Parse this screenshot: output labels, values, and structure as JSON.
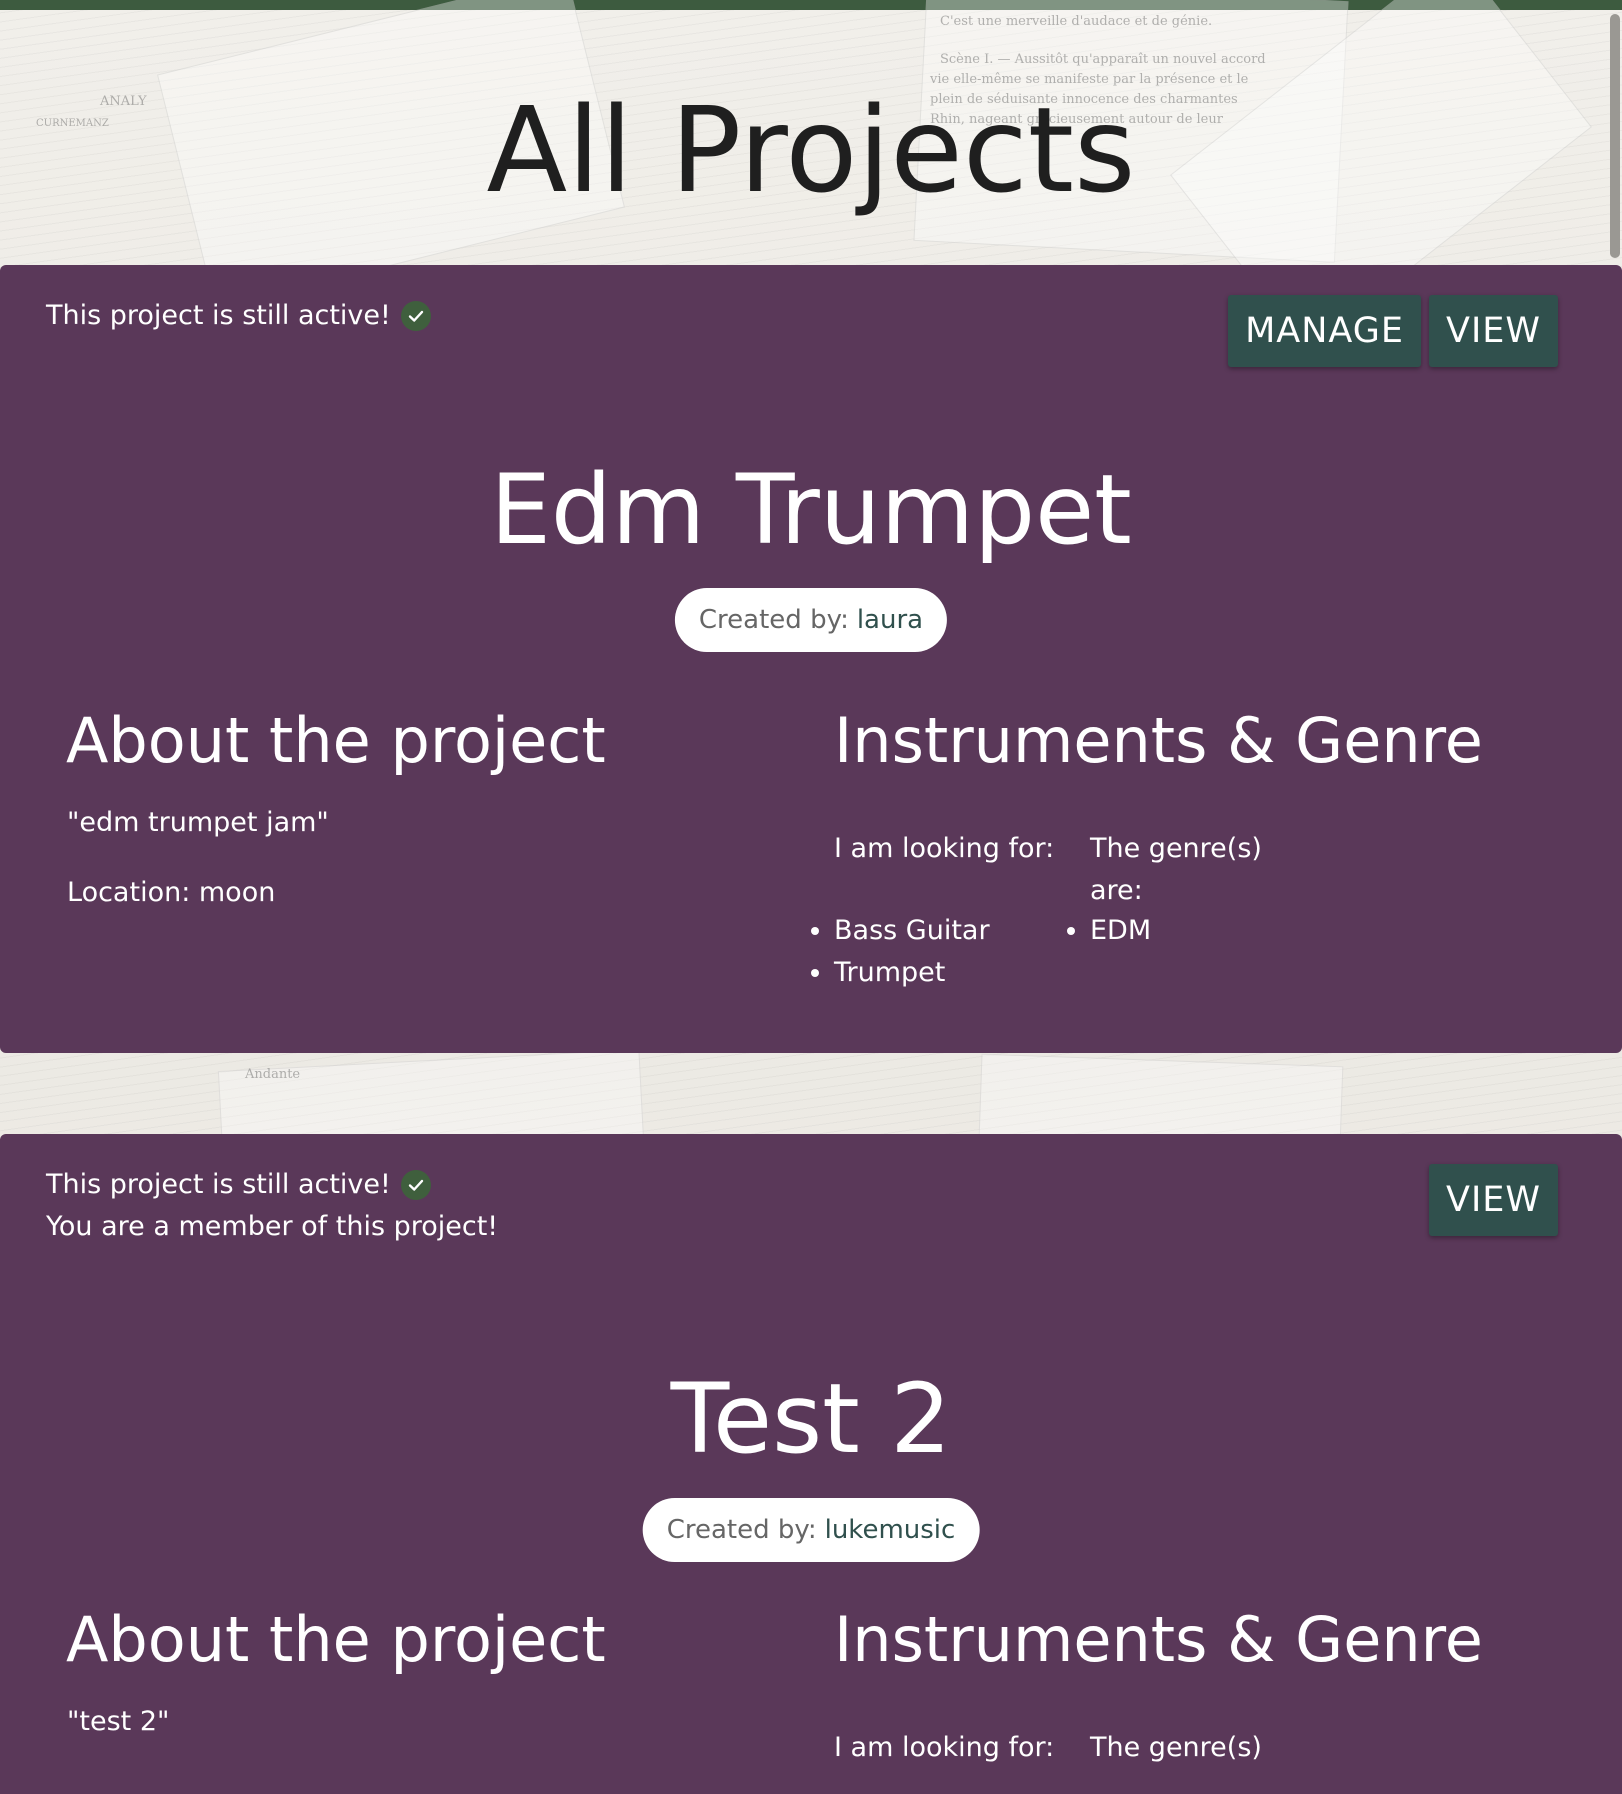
{
  "page": {
    "title": "All Projects"
  },
  "colors": {
    "top_strip": "#3d5b3f",
    "card_background": "#5a3859",
    "button_background": "#30504d",
    "check_badge": "#3f5f3d"
  },
  "projects": [
    {
      "status_text": "This project is still active!",
      "member_text": "",
      "buttons": {
        "manage_label": "MANAGE",
        "view_label": "VIEW"
      },
      "title": "Edm Trumpet",
      "creator_label": "Created by:",
      "creator_name": "laura",
      "about_heading": "About the project",
      "description": "\"edm trumpet jam\"",
      "location": "Location: moon",
      "instruments_heading": "Instruments & Genre",
      "looking_for_label": "I am looking for:",
      "genre_label": "The genre(s) are:",
      "instruments": [
        "Bass Guitar",
        "Trumpet"
      ],
      "genres": [
        "EDM"
      ]
    },
    {
      "status_text": "This project is still active!",
      "member_text": "You are a member of this project!",
      "buttons": {
        "view_label": "VIEW"
      },
      "title": "Test 2",
      "creator_label": "Created by:",
      "creator_name": "lukemusic",
      "about_heading": "About the project",
      "description": "\"test 2\"",
      "instruments_heading": "Instruments & Genre",
      "looking_for_label": "I am looking for:",
      "genre_label": "The genre(s)"
    }
  ]
}
